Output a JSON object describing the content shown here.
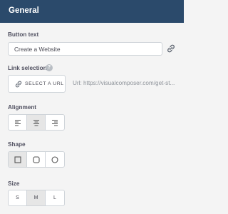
{
  "header": {
    "title": "General"
  },
  "button_text": {
    "label": "Button text",
    "value": "Create a Website"
  },
  "link_selection": {
    "label": "Link selection",
    "help": "?",
    "select_button_label": "SELECT A URL",
    "url_text": "Url: https://visualcomposer.com/get-st..."
  },
  "alignment": {
    "label": "Alignment",
    "options": [
      "align-left-icon",
      "align-center-icon",
      "align-right-icon"
    ],
    "selected": "center"
  },
  "shape": {
    "label": "Shape",
    "options": [
      "square-shape-icon",
      "rounded-shape-icon",
      "round-shape-icon"
    ],
    "selected": "square"
  },
  "size": {
    "label": "Size",
    "options": [
      "S",
      "M",
      "L"
    ],
    "selected": "M"
  },
  "colors": {
    "header_bg": "#2b4a6b",
    "panel_bg": "#f4f4f4",
    "active_segment": "#e6e6e6"
  }
}
